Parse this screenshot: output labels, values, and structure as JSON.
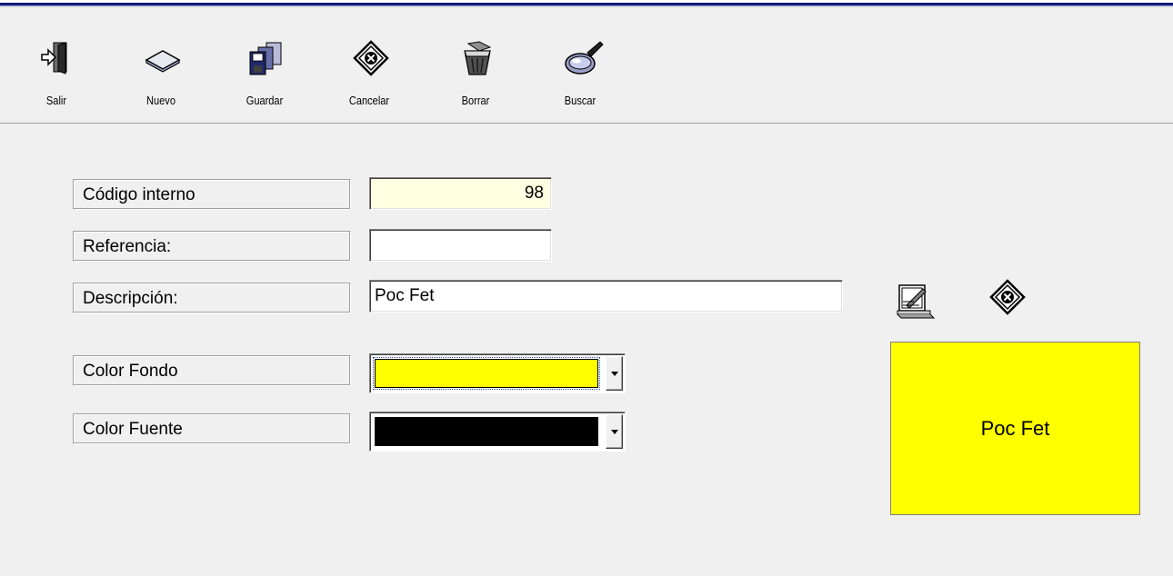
{
  "toolbar": {
    "items": [
      {
        "label": "Salir",
        "icon": "exit-door-icon"
      },
      {
        "label": "Nuevo",
        "icon": "new-document-icon"
      },
      {
        "label": "Guardar",
        "icon": "save-disks-icon"
      },
      {
        "label": "Cancelar",
        "icon": "cancel-x-icon"
      },
      {
        "label": "Borrar",
        "icon": "trash-bin-icon"
      },
      {
        "label": "Buscar",
        "icon": "magnifier-icon"
      }
    ]
  },
  "form": {
    "codigo_label": "Código interno",
    "codigo_value": "98",
    "referencia_label": "Referencia:",
    "referencia_value": "",
    "descripcion_label": "Descripción:",
    "descripcion_value": "Poc Fet",
    "color_fondo_label": "Color Fondo",
    "color_fondo_value": "#ffff00",
    "color_fuente_label": "Color Fuente",
    "color_fuente_value": "#000000"
  },
  "preview": {
    "text": "Poc Fet",
    "background": "#ffff00",
    "color": "#000000"
  },
  "colors": {
    "codigo_field_bg": "#ffffe1",
    "title_bar": "#0a1c78"
  }
}
